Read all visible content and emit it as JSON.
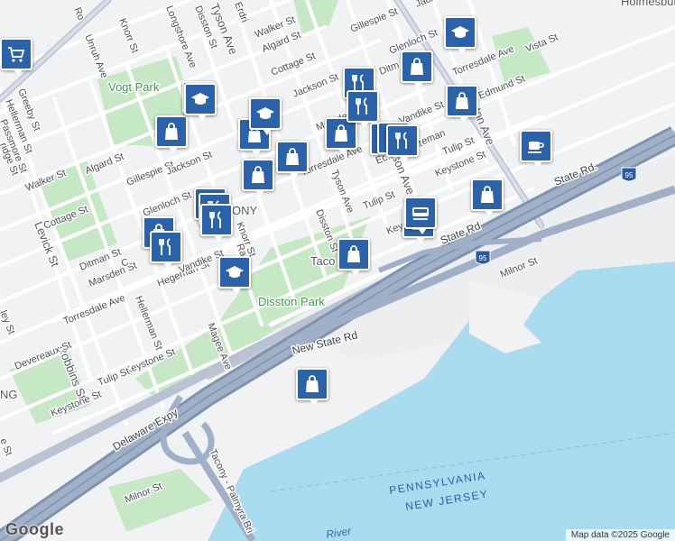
{
  "map": {
    "attribution": "Map data ©2025 Google",
    "logo": "Google",
    "neighborhoods": {
      "holmesburg": "Holmesburg",
      "tacony": "TACONY",
      "tacony_small": "Taco",
      "wissinoming_partial": "NG"
    },
    "parks": {
      "vogt": "Vogt Park",
      "disston": "Disston Park"
    },
    "water": {
      "state_pa": "PENNSYLVANIA",
      "state_nj": "NEW JERSEY",
      "river": "River"
    },
    "highway": {
      "shield": "95"
    },
    "streets": {
      "torresdale_1": "Torresdale Ave",
      "torresdale_2": "Torresdale Ave",
      "torresdale_3": "Torresdale Ave",
      "new_state_rd": "New State Rd",
      "state_rd_1": "State Rd",
      "state_rd_2": "State Rd.",
      "milnor_1": "Milnor St",
      "milnor_2": "Milnor St",
      "delaware_expy": "Delaware Expy",
      "tacony_palmyra": "Tacony - Palmyra Bri",
      "levick": "Levick St",
      "robbins": "Robbins St",
      "devereaux_1": "Devereaux St",
      "devereaux_2": "Devereaux St",
      "keystone_1": "Keystone St",
      "keystone_2": "Keystone St",
      "keystone_3": "Keystone St",
      "keystone_4": "Keystone",
      "tulip_1": "Tulip St",
      "tulip_2": "Tulip St",
      "tulip_3": "Tulip St",
      "magee": "Magee Ave",
      "hellerman_1": "Hellerman St",
      "hellerman_2": "Hellerman St",
      "hegeman_1": "Hegeman St",
      "hegeman_2": "Hegeman",
      "hegeman_3": "Hegeman St",
      "vandike_1": "Vandike St",
      "vandike_2": "Vandike St",
      "marsden_1": "Marsden St",
      "marsden_2": "Marsden",
      "ditman_1": "Ditman St",
      "ditman_2": "Ditm",
      "glenloch_1": "Glenloch St",
      "glenloch_2": "Glenloch St",
      "gillespie_1": "Gillespie St",
      "gillespie_2": "Gillespie St",
      "jackson_1": "Jackson St",
      "jackson_2": "Jackson St",
      "jackson_3": "Jacks",
      "cottage_1": "Cottage St",
      "cottage_2": "Cottage St",
      "algard_1": "Algard St",
      "algard_2": "Algard St",
      "walker_1": "Walker St",
      "walker_2": "Walker St",
      "greeby": "Greeby St",
      "hellerman_w": "Hellerman St",
      "passmore": "Passmore St",
      "wiridge": "ridge St",
      "unruh": "Unruh Ave",
      "knorr_1": "Knorr St",
      "knorr_2": "Knorr St",
      "longshore": "Longshore Ave",
      "disston_1": "Disston St",
      "disston_2": "Disston St",
      "erdrick": "Erdri",
      "tyson_1": "Tyson Ave",
      "tyson_2": "Tyson Ave",
      "tyson_3": "yson Ave",
      "tyson_4": "ton Ave",
      "edmund_1": "Edmund St",
      "edmund_2": "Edmund St",
      "vista": "Vista St",
      "rawle": "Ra",
      "ro": "Ro",
      "ley": "ley St",
      "c_st": "C",
      "e_st": "e St"
    },
    "pois": [
      {
        "type": "shopping",
        "icon": "shopping-bag-icon"
      },
      {
        "type": "shopping",
        "icon": "shopping-bag-icon"
      },
      {
        "type": "shopping",
        "icon": "shopping-bag-icon"
      },
      {
        "type": "shopping",
        "icon": "shopping-bag-icon"
      },
      {
        "type": "shopping",
        "icon": "shopping-bag-icon"
      },
      {
        "type": "shopping",
        "icon": "shopping-bag-icon"
      },
      {
        "type": "shopping",
        "icon": "shopping-bag-icon"
      },
      {
        "type": "shopping",
        "icon": "shopping-bag-icon"
      },
      {
        "type": "shopping",
        "icon": "shopping-bag-icon"
      },
      {
        "type": "shopping",
        "icon": "shopping-bag-icon"
      },
      {
        "type": "shopping",
        "icon": "shopping-bag-icon"
      },
      {
        "type": "shopping",
        "icon": "shopping-bag-icon"
      },
      {
        "type": "restaurant",
        "icon": "fork-knife-icon"
      },
      {
        "type": "restaurant",
        "icon": "fork-knife-icon"
      },
      {
        "type": "restaurant",
        "icon": "fork-knife-icon"
      },
      {
        "type": "restaurant",
        "icon": "fork-knife-icon"
      },
      {
        "type": "restaurant",
        "icon": "fork-knife-icon"
      },
      {
        "type": "restaurant",
        "icon": "fork-knife-icon"
      },
      {
        "type": "restaurant",
        "icon": "fork-knife-icon"
      },
      {
        "type": "restaurant",
        "icon": "fork-knife-icon"
      },
      {
        "type": "restaurant",
        "icon": "fork-knife-icon"
      },
      {
        "type": "school",
        "icon": "graduation-cap-icon"
      },
      {
        "type": "school",
        "icon": "graduation-cap-icon"
      },
      {
        "type": "school",
        "icon": "graduation-cap-icon"
      },
      {
        "type": "school",
        "icon": "graduation-cap-icon"
      },
      {
        "type": "school",
        "icon": "graduation-cap-icon"
      },
      {
        "type": "cafe",
        "icon": "coffee-cup-icon"
      },
      {
        "type": "transit",
        "icon": "train-icon"
      },
      {
        "type": "grocery",
        "icon": "shopping-cart-icon"
      }
    ],
    "colors": {
      "water": "#a9dcef",
      "park": "#c6e8c4",
      "highway": "#8fa0b8",
      "poi": "#2c63a8"
    }
  }
}
